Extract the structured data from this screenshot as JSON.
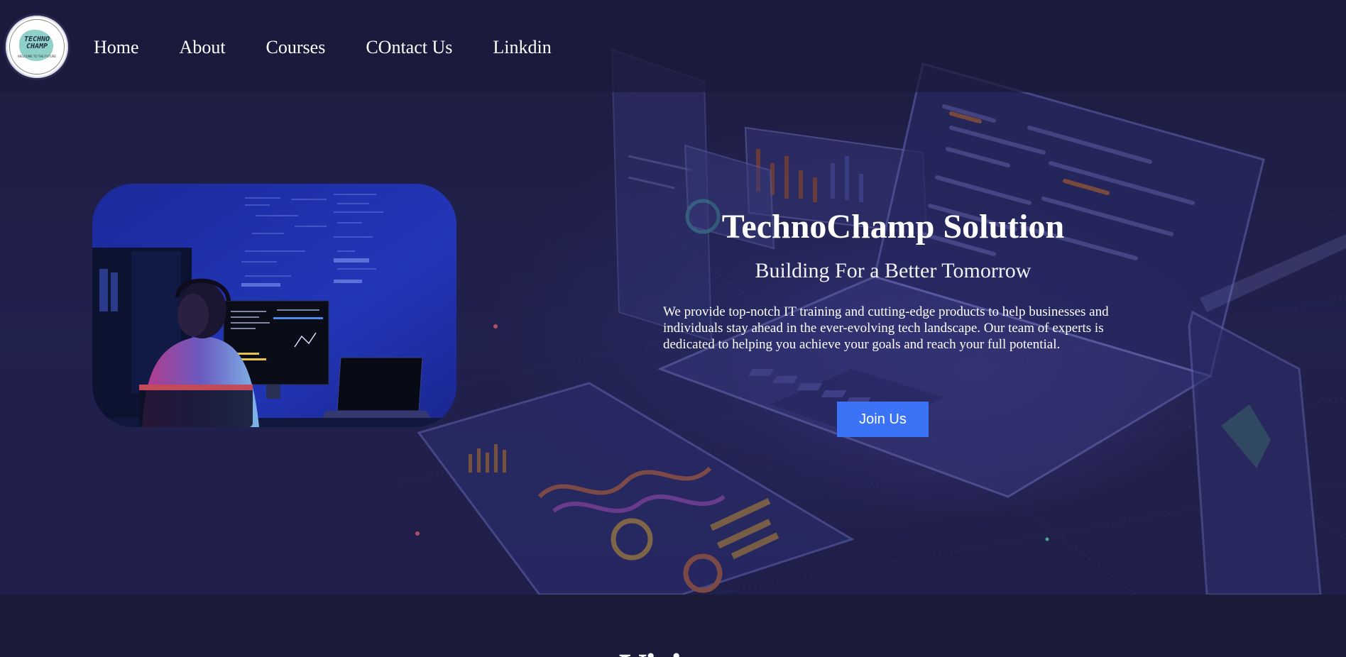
{
  "logo": {
    "line1": "TECHNO",
    "line2": "CHAMP",
    "tagline": "WELCOME TO THE FUTURE"
  },
  "nav": {
    "items": [
      {
        "label": "Home"
      },
      {
        "label": "About"
      },
      {
        "label": "Courses"
      },
      {
        "label": "COntact Us"
      },
      {
        "label": "Linkdin"
      }
    ]
  },
  "hero": {
    "title": "TechnoChamp Solution",
    "subtitle": "Building For a Better Tomorrow",
    "description": "We provide top-notch IT training and cutting-edge products to help businesses and individuals stay ahead in the ever-evolving tech landscape. Our team of experts is dedicated to helping you achieve your goals and reach your full potential.",
    "cta_label": "Join Us"
  },
  "next_section": {
    "title": "Vision"
  },
  "colors": {
    "background": "#1b1a38",
    "cta": "#3a73f5",
    "text": "#ffffff"
  }
}
